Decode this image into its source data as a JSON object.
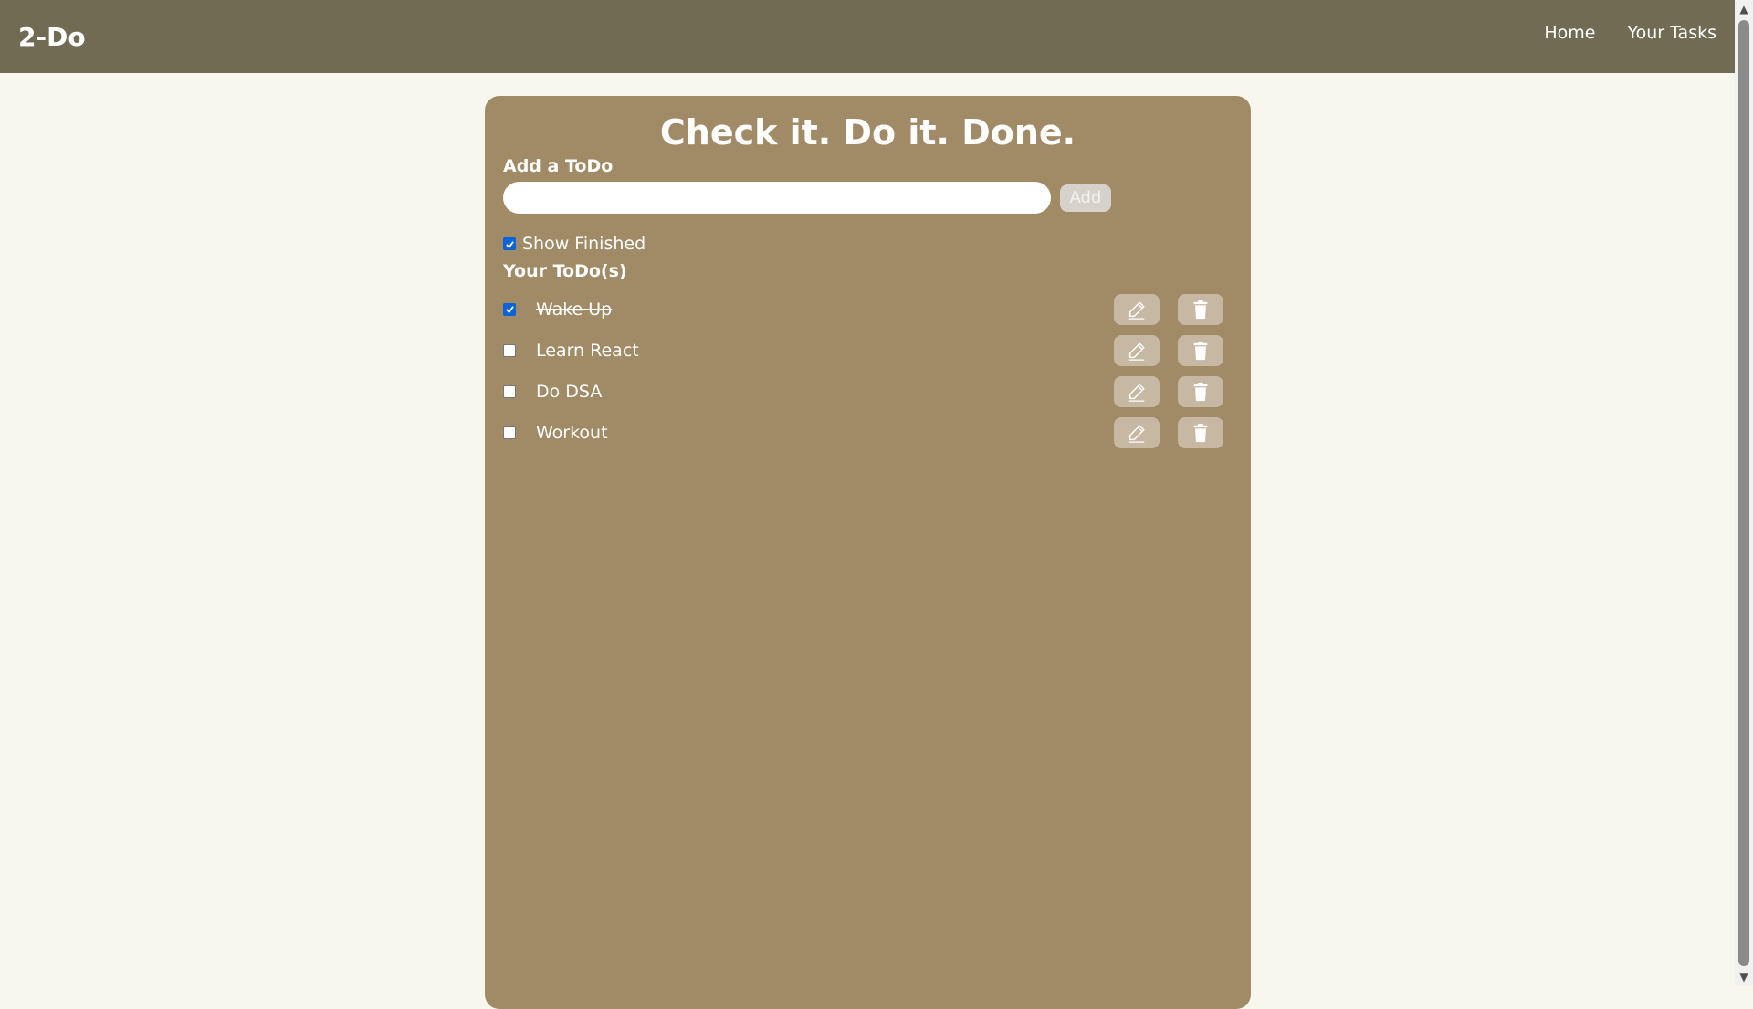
{
  "navbar": {
    "brand": "2-Do",
    "links": [
      "Home",
      "Your Tasks"
    ]
  },
  "card": {
    "title": "Check it. Do it. Done.",
    "add_label": "Add a ToDo",
    "add_input": {
      "value": "",
      "placeholder": ""
    },
    "add_button": "Add",
    "show_finished": {
      "label": "Show Finished",
      "checked": true
    },
    "todos_heading": "Your ToDo(s)",
    "todos": [
      {
        "text": "Wake Up",
        "done": true
      },
      {
        "text": "Learn React",
        "done": false
      },
      {
        "text": "Do DSA",
        "done": false
      },
      {
        "text": "Workout",
        "done": false
      }
    ]
  },
  "icons": {
    "edit": "pencil-icon",
    "delete": "trash-icon"
  },
  "colors": {
    "navbar": "#726b54",
    "background": "#f8f7ed",
    "card": "#a18a66",
    "button": "#c6b8a2",
    "checkbox_checked": "#0b63d8"
  }
}
